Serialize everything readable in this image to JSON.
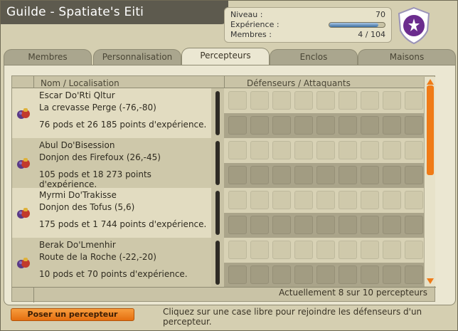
{
  "window": {
    "title": "Guilde - Spatiate's Eiti"
  },
  "stats": {
    "level_label": "Niveau :",
    "level_value": "70",
    "xp_label": "Expérience :",
    "xp_progress": 0.88,
    "members_label": "Membres :",
    "members_value": "4 / 104"
  },
  "tabs": [
    {
      "label": "Membres",
      "active": false
    },
    {
      "label": "Personnalisation",
      "active": false
    },
    {
      "label": "Percepteurs",
      "active": true
    },
    {
      "label": "Enclos",
      "active": false
    },
    {
      "label": "Maisons",
      "active": false
    }
  ],
  "table": {
    "col_name": "Nom / Localisation",
    "col_defenders": "Défenseurs / Attaquants",
    "rows": [
      {
        "name": "Escar Do'Rti Qltur",
        "location": "La crevasse Perge (-76,-80)",
        "info": "76 pods et 26 185 points d'expérience."
      },
      {
        "name": "Abul Do'Bisession",
        "location": "Donjon des Firefoux (26,-45)",
        "info": "105 pods et 18 273 points d'expérience."
      },
      {
        "name": "Myrmi Do'Trakisse",
        "location": "Donjon des Tofus (5,6)",
        "info": "175 pods et 1 744 points d'expérience."
      },
      {
        "name": "Berak Do'Lmenhir",
        "location": "Route de la Roche (-22,-20)",
        "info": "10 pods et 70 points d'expérience."
      }
    ],
    "count_text": "Actuellement 8 sur 10 percepteurs"
  },
  "footer": {
    "button_label": "Poser un percepteur",
    "hint": "Cliquez sur une case libre pour rejoindre les défenseurs d'un percepteur."
  },
  "icons": {
    "emblem": "guild-emblem-icon",
    "bag": "percepteur-bag-icon"
  },
  "colors": {
    "accent": "#f07b17",
    "title_bar": "#5d5a4e",
    "panel": "#ebe7d2"
  }
}
